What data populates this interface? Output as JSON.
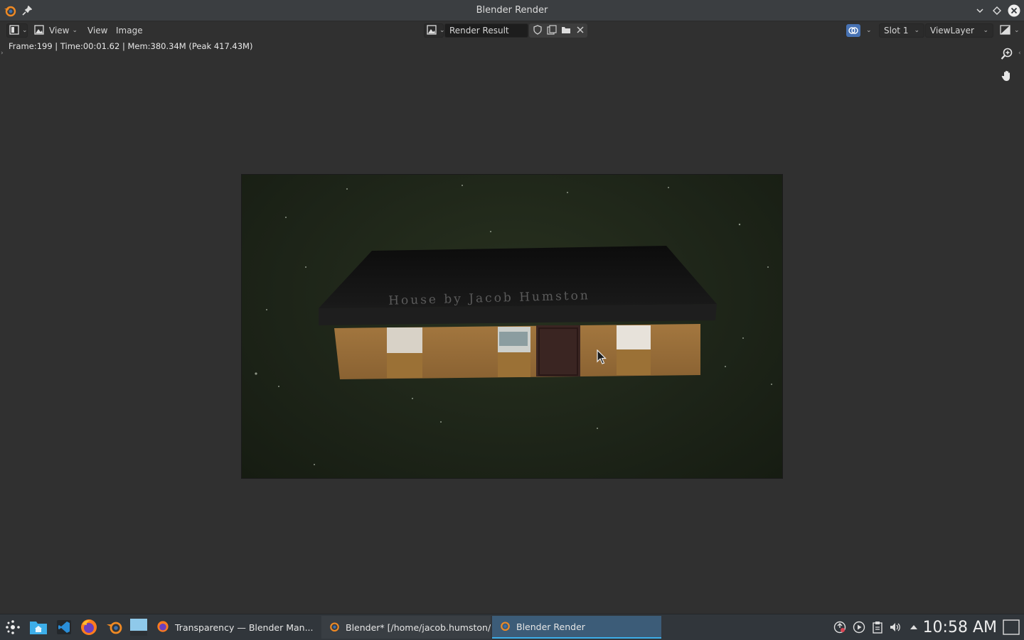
{
  "window": {
    "title": "Blender Render"
  },
  "header": {
    "menu_view_dropdown": "View",
    "menu_view": "View",
    "menu_image": "Image",
    "image_name": "Render Result",
    "slot": "Slot 1",
    "view_layer": "ViewLayer"
  },
  "status": {
    "text": "Frame:199 | Time:00:01.62 | Mem:380.34M (Peak 417.43M)"
  },
  "render": {
    "signage": "House by Jacob Humston"
  },
  "taskbar": {
    "tasks": [
      {
        "label": "Transparency — Blender Man..."
      },
      {
        "label": "Blender* [/home/jacob.humston/..."
      },
      {
        "label": "Blender Render"
      }
    ],
    "clock": "10:58 AM"
  }
}
